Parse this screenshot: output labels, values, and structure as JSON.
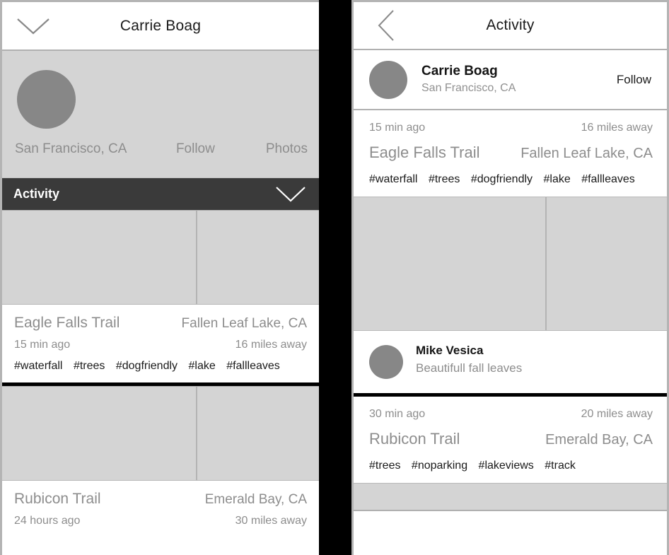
{
  "left_screen": {
    "navbar": {
      "title": "Carrie Boag",
      "icon": "chevron-down-icon"
    },
    "profile": {
      "location": "San Francisco, CA",
      "follow_label": "Follow",
      "photos_label": "Photos",
      "avatar": "avatar-placeholder"
    },
    "section_bar": {
      "label": "Activity",
      "icon": "chevron-down-icon"
    },
    "cards": [
      {
        "title": "Eagle Falls Trail",
        "place": "Fallen Leaf Lake, CA",
        "time": "15 min ago",
        "distance": "16 miles away",
        "tags": [
          "#waterfall",
          "#trees",
          "#dogfriendly",
          "#lake",
          "#fallleaves"
        ]
      },
      {
        "title": "Rubicon Trail",
        "place": "Emerald Bay, CA",
        "time": "24 hours ago",
        "distance": "30 miles away",
        "tags": []
      }
    ]
  },
  "right_screen": {
    "navbar": {
      "title": "Activity",
      "icon": "chevron-left-icon"
    },
    "profile_row": {
      "name": "Carrie Boag",
      "location": "San Francisco, CA",
      "action_label": "Follow",
      "avatar": "avatar-placeholder"
    },
    "cards": [
      {
        "time": "15 min ago",
        "distance": "16 miles away",
        "title": "Eagle Falls Trail",
        "place": "Fallen Leaf Lake, CA",
        "tags": [
          "#waterfall",
          "#trees",
          "#dogfriendly",
          "#lake",
          "#fallleaves"
        ],
        "comment": {
          "author": "Mike Vesica",
          "text": "Beautifull fall leaves",
          "avatar": "avatar-placeholder"
        }
      },
      {
        "time": "30 min ago",
        "distance": "20 miles away",
        "title": "Rubicon Trail",
        "place": "Emerald Bay, CA",
        "tags": [
          "#trees",
          "#noparking",
          "#lakeviews",
          "#track"
        ]
      }
    ]
  },
  "colors": {
    "gutter": "#000000",
    "placeholder": "#d4d4d4",
    "avatar": "#878787",
    "muted_text": "#8d8d8d",
    "dark_bar": "#3a3a3a",
    "divider": "#000000"
  }
}
